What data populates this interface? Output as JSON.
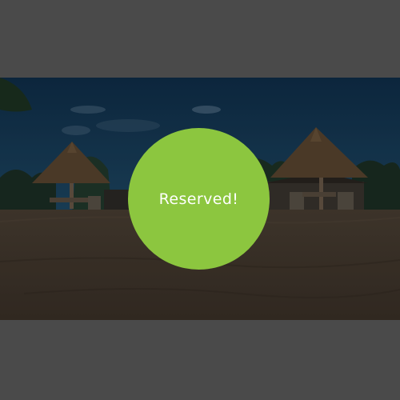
{
  "overlay": {
    "badge_text": "Reserved!",
    "badge_color": "#8cc63f"
  },
  "photo": {
    "subject": "beach-resort-thatched-umbrellas-image"
  }
}
